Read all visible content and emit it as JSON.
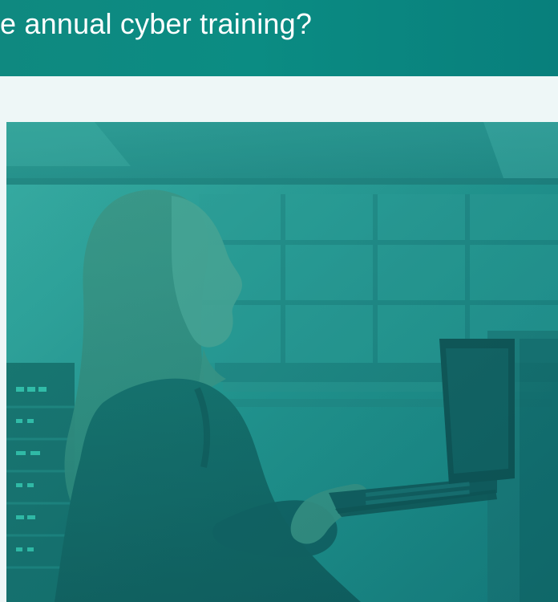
{
  "header": {
    "title": "e annual cyber training?"
  },
  "hero": {
    "image_icon": "person-with-laptop-photo",
    "tint_color": "#11918a",
    "dark_tone": "#0c4a4b"
  },
  "colors": {
    "banner": "#0b8c83",
    "band": "#eef7f7",
    "text_on_banner": "#ffffff"
  }
}
